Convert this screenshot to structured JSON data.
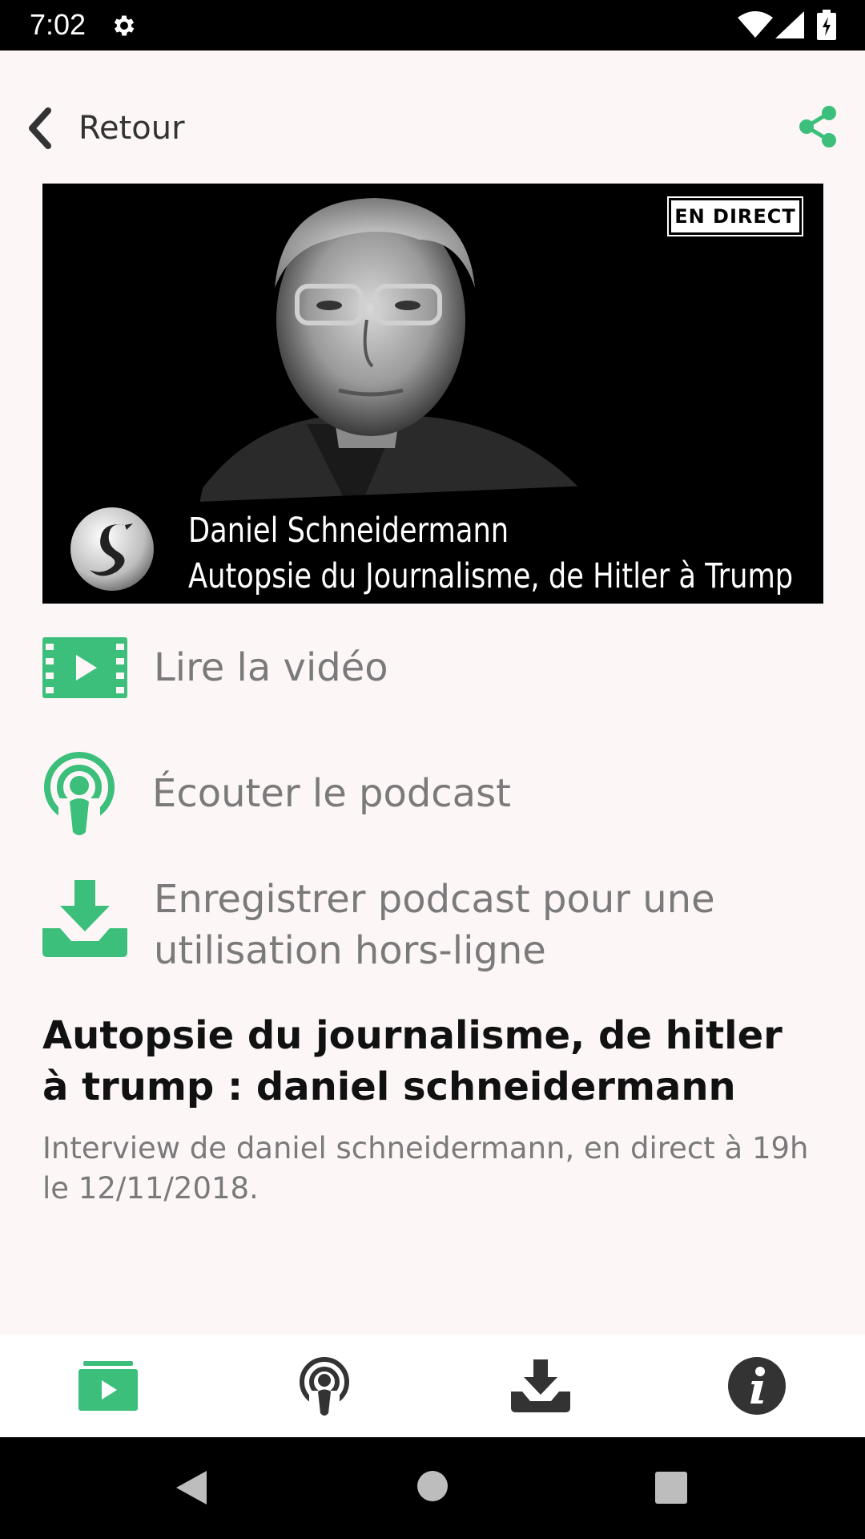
{
  "status_bar": {
    "time": "7:02",
    "icons": [
      "gear-icon",
      "wifi-icon",
      "signal-icon",
      "battery-charging-icon"
    ]
  },
  "header": {
    "back_label": "Retour",
    "back_icon": "chevron-left-icon",
    "share_icon": "share-icon"
  },
  "thumbnail": {
    "badge": "EN DIRECT",
    "caption_name": "Daniel Schneidermann",
    "caption_subtitle": "Autopsie du Journalisme, de Hitler à Trump",
    "logo": "swan-logo"
  },
  "actions": [
    {
      "label": "Lire la vidéo",
      "icon": "video-play-icon"
    },
    {
      "label": "Écouter le podcast",
      "icon": "podcast-icon"
    },
    {
      "label": "Enregistrer podcast pour une utilisation hors-ligne",
      "icon": "download-icon"
    }
  ],
  "episode": {
    "title": "Autopsie du journalisme, de hitler à trump : daniel schneidermann",
    "description": "Interview de daniel schneidermann, en direct à 19h le 12/11/2018."
  },
  "bottom_nav": [
    {
      "name": "videos",
      "icon": "video-icon",
      "active": true
    },
    {
      "name": "podcasts",
      "icon": "podcast-icon",
      "active": false
    },
    {
      "name": "downloads",
      "icon": "download-icon",
      "active": false
    },
    {
      "name": "info",
      "icon": "info-icon",
      "active": false
    }
  ],
  "colors": {
    "accent": "#3cbf7a",
    "background": "#fdf6f7",
    "text_muted": "#7a7a7a",
    "text_dark": "#111111",
    "nav_icon_dark": "#333333"
  }
}
